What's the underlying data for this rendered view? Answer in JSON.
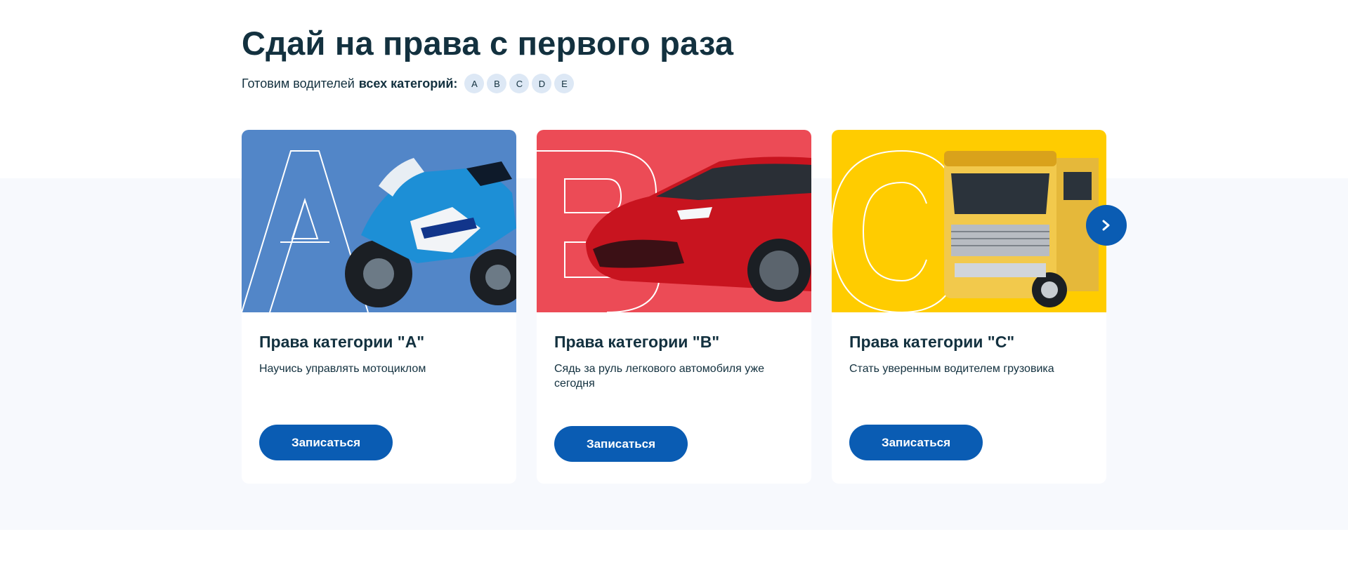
{
  "header": {
    "title_part1": "Сдай на права с ",
    "title_highlight": "первого",
    "title_part2": " раза",
    "subtitle_prefix": "Готовим водителей",
    "subtitle_bold": "всех категорий:",
    "categories": [
      "A",
      "B",
      "C",
      "D",
      "E"
    ]
  },
  "cards": [
    {
      "title": "Права категории \"A\"",
      "description": "Научись управлять мотоциклом",
      "button": "Записаться",
      "letter": "A",
      "color": "#5286c8",
      "icon": "motorcycle-image"
    },
    {
      "title": "Права категории \"B\"",
      "description": "Сядь за руль легкового автомобиля уже сегодня",
      "button": "Записаться",
      "letter": "B",
      "color": "#ec4b56",
      "icon": "car-image"
    },
    {
      "title": "Права категории \"C\"",
      "description": "Стать уверенным водителем грузовика",
      "button": "Записаться",
      "letter": "C",
      "color": "#ffcc00",
      "icon": "truck-image"
    }
  ],
  "slider": {
    "next_icon": "chevron-right-icon"
  },
  "colors": {
    "accent": "#0a5cb3",
    "text": "#13313f",
    "band": "#f7f9fd"
  }
}
